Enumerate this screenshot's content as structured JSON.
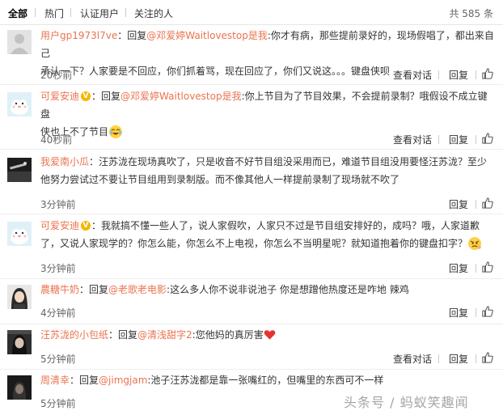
{
  "tabs": [
    {
      "label": "全部"
    },
    {
      "label": "热门"
    },
    {
      "label": "认证用户"
    },
    {
      "label": "关注的人"
    }
  ],
  "total": "共 585 条",
  "actions": {
    "view": "查看对话",
    "reply": "回复"
  },
  "comments": [
    {
      "user": "用户gp1973l7ve",
      "lines": [
        {
          "pre": "：回复",
          "mention": "@邓爱婷Waitlovestop是我",
          "post": ":你才有病，那些提前录好的，现场假唱了，都出来自己"
        },
        {
          "text": "承认一下？人家要是不回应，你们抓着骂，现在回应了，你们又说这。。。键盘侠呗"
        }
      ],
      "time": "20秒前"
    },
    {
      "user": "可爱安迪",
      "verified": true,
      "lines": [
        {
          "pre": "：回复",
          "mention": "@邓爱婷Waitlovestop是我",
          "post": ":你上节目为了节目效果，不会提前录制？哦假设不成立键盘"
        },
        {
          "text": "侠也上不了节目"
        }
      ],
      "emoji": "laugh-cry-emoji",
      "time": "40秒前"
    },
    {
      "user": "我爱南小瓜",
      "lines": [
        {
          "pre": "：汪苏泷在现场真吹了，只是收音不好节目组没采用而已，难道节目组没用要怪汪苏泷？至少"
        },
        {
          "text": "他努力尝试过不要让节目组用到录制版。而不像其他人一样提前录制了现场就不吹了"
        }
      ],
      "time": "3分钟前"
    },
    {
      "user": "可爱安迪",
      "verified": true,
      "lines": [
        {
          "pre": "：我就搞不懂一些人了，说人家假吹，人家只不过是节目组安排好的，成吗？哦，人家道歉"
        },
        {
          "text": "了，又说人家现学的？你怎么能，你怎么不上电视，你怎么不当明星呢？就知道抱着你的键盘扣字？"
        }
      ],
      "emoji": "angry-emoji",
      "time": "3分钟前"
    },
    {
      "user": "農糖牛奶",
      "lines": [
        {
          "pre": "：回复",
          "mention": "@老歌老电影",
          "post": ":这么多人你不说非说池子 你是想蹭他热度还是咋地 辣鸡"
        }
      ],
      "time": "4分钟前"
    },
    {
      "user": "汪苏泷的小包纸",
      "lines": [
        {
          "pre": "：回复",
          "mention": "@清浅甜字2",
          "post": ":您他妈的真厉害"
        }
      ],
      "emoji": "heart-icon",
      "time": "5分钟前"
    },
    {
      "user": "周清幸",
      "lines": [
        {
          "pre": "：回复",
          "mention": "@jimgjam",
          "post": ":池子汪苏泷都是靠一张嘴红的，但嘴里的东西可不一样"
        }
      ],
      "time": "5分钟前"
    }
  ],
  "watermark": "头条号 / 蚂蚁笑趣闻"
}
